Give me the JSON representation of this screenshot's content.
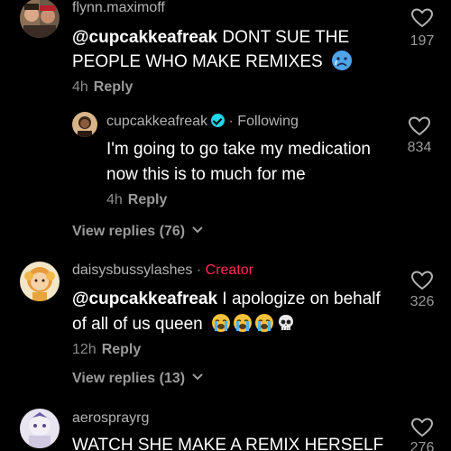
{
  "comments": [
    {
      "username": "flynn.maximoff",
      "mention": "@cupcakkeafreak",
      "text_line1": " DONT SUE THE",
      "text_line2": "PEOPLE WHO MAKE REMIXES",
      "time": "4h",
      "reply_label": "Reply",
      "likes": "197",
      "emoji": "crying-face"
    },
    {
      "username": "cupcakkeafreak",
      "following_label": "Following",
      "text_line1": "I'm going to go take my medication",
      "text_line2": "now this is to much for me",
      "time": "4h",
      "reply_label": "Reply",
      "likes": "834",
      "view_replies": "View replies (76)"
    },
    {
      "username": "daisysbussylashes",
      "creator_label": "Creator",
      "mention": "@cupcakkeafreak",
      "text_line1": " I apologize on behalf",
      "text_line2": "of all of us queen",
      "time": "12h",
      "reply_label": "Reply",
      "likes": "326",
      "view_replies": "View replies (13)",
      "emojis": [
        "loudly-crying-face",
        "loudly-crying-face",
        "loudly-crying-face",
        "skull"
      ]
    },
    {
      "username": "aerosprayrg",
      "text_line1": "WATCH SHE MAKE A REMIX HERSELF",
      "likes": "276"
    }
  ],
  "separator": "·",
  "colors": {
    "background": "#000000",
    "creator": "#fe2c55",
    "verified": "#20d5ec"
  }
}
